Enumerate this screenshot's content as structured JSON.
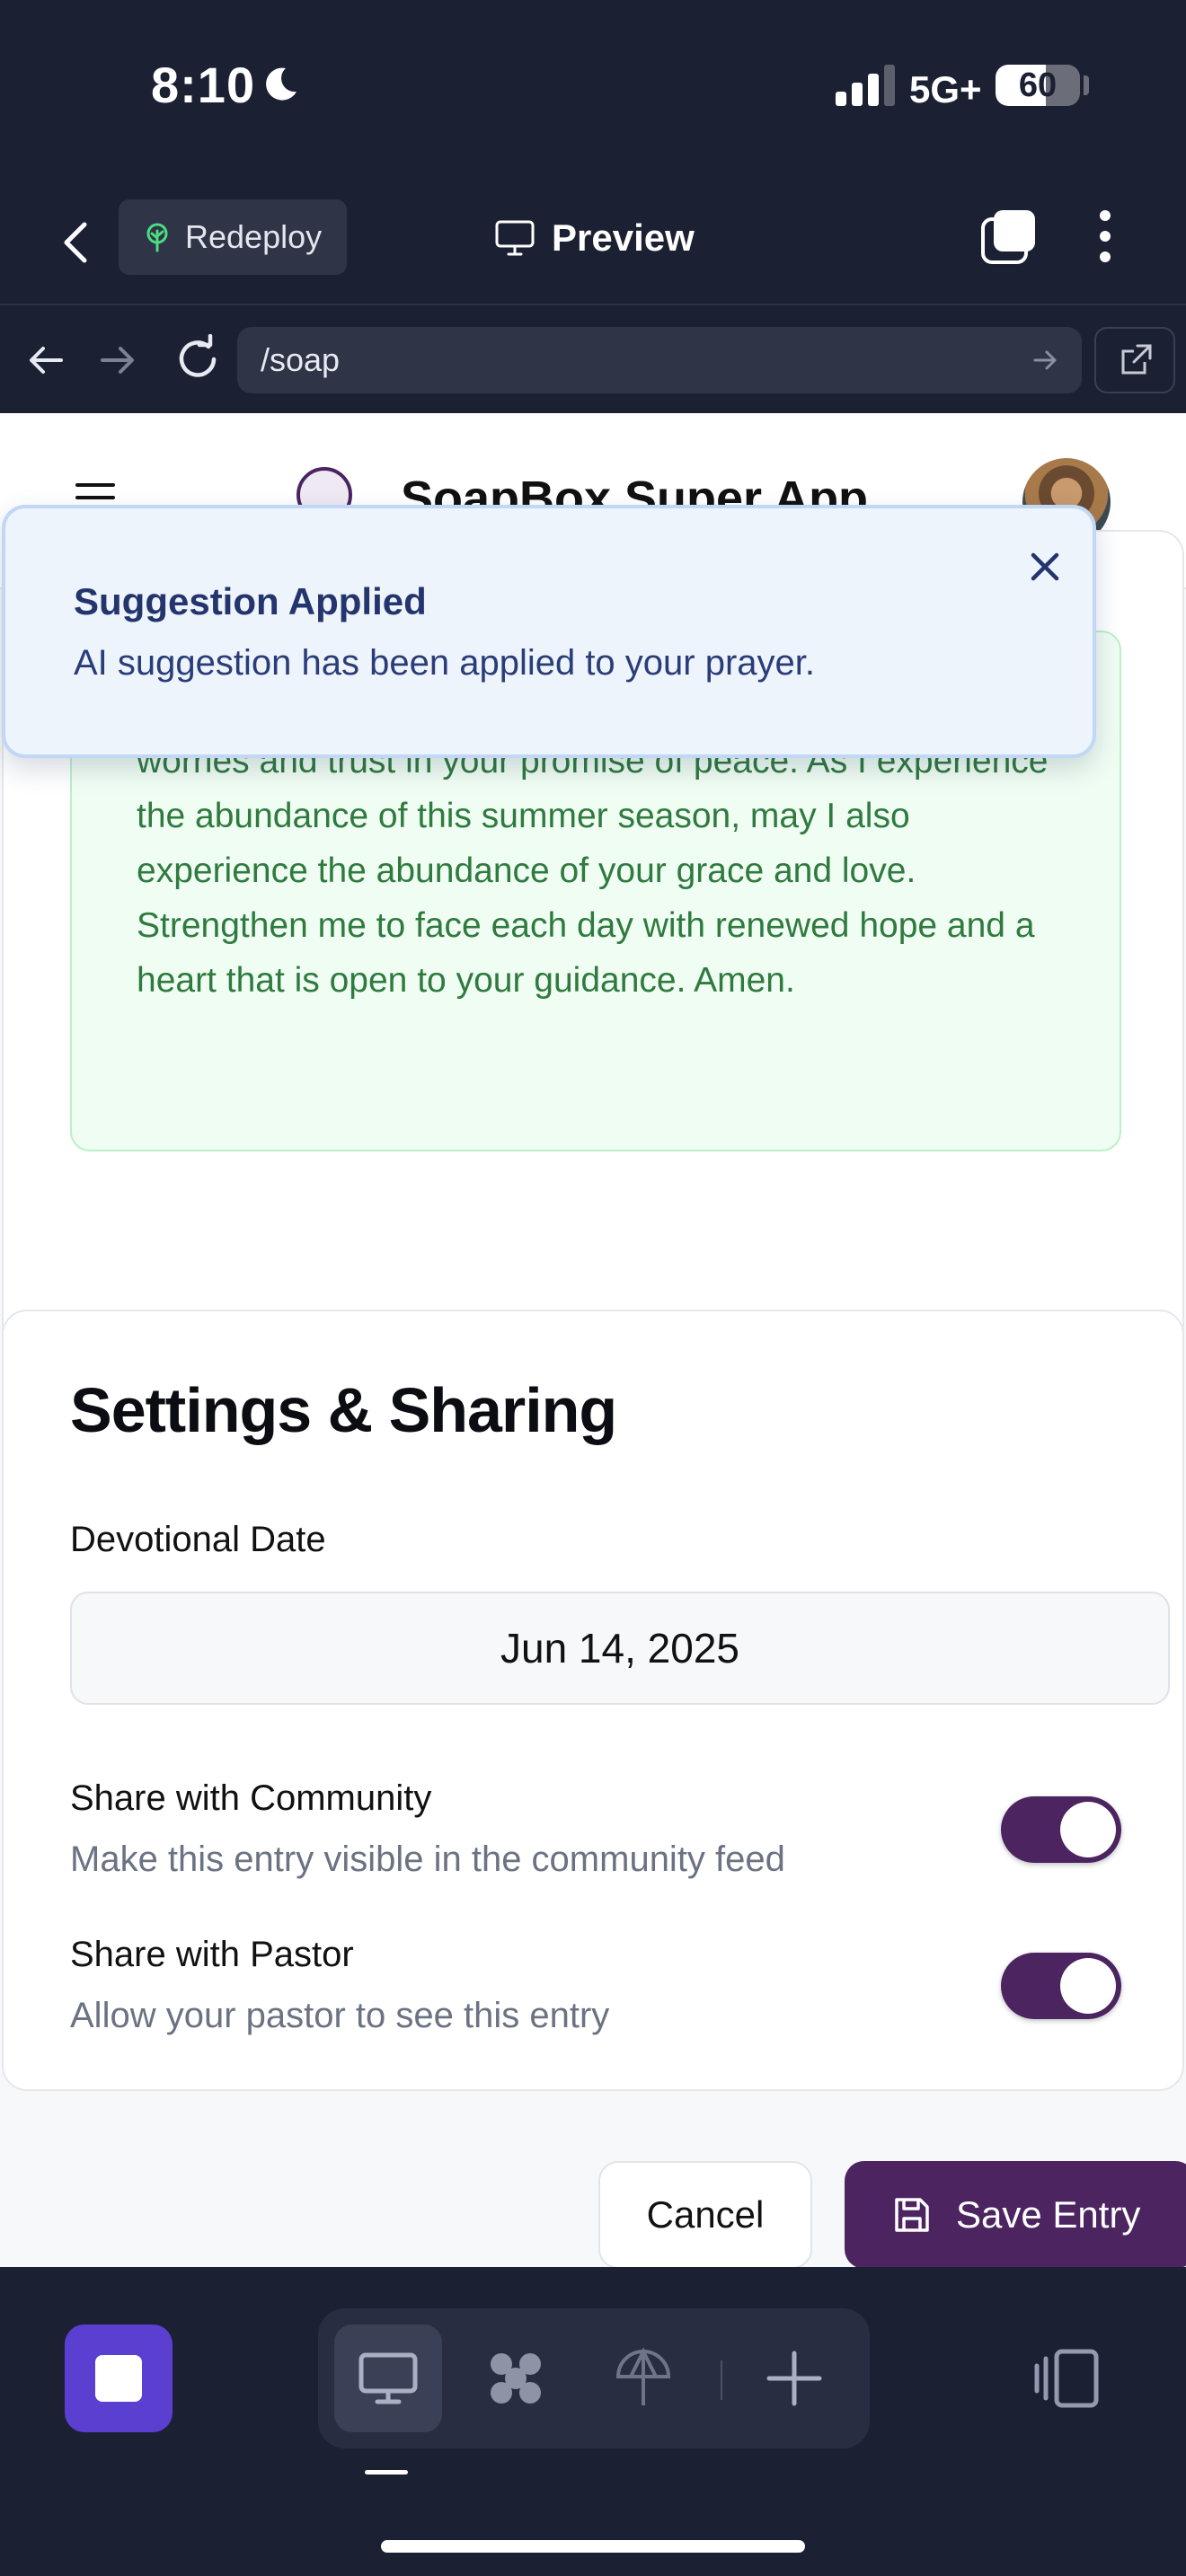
{
  "status_bar": {
    "time": "8:10",
    "network": "5G+",
    "battery": "60",
    "battery_level": 0.6
  },
  "app_bar": {
    "redeploy_label": "Redeploy",
    "preview_label": "Preview"
  },
  "browser": {
    "url": "/soap"
  },
  "site": {
    "title": "SoapBox Super App"
  },
  "prayer": {
    "text": "to find true rest in your presence. Teach me to release my worries and trust in your promise of peace. As I experience the abundance of this summer season, may I also experience the abundance of your grace and love. Strengthen me to face each day with renewed hope and a heart that is open to your guidance. Amen."
  },
  "toast": {
    "title": "Suggestion Applied",
    "message": "AI suggestion has been applied to your prayer."
  },
  "settings": {
    "title": "Settings & Sharing",
    "date_label": "Devotional Date",
    "date_value": "Jun 14, 2025",
    "share_community": {
      "title": "Share with Community",
      "subtitle": "Make this entry visible in the community feed",
      "enabled": true
    },
    "share_pastor": {
      "title": "Share with Pastor",
      "subtitle": "Allow your pastor to see this entry",
      "enabled": true
    }
  },
  "actions": {
    "cancel_label": "Cancel",
    "save_label": "Save Entry"
  },
  "colors": {
    "brand": "#4b2460",
    "toast_bg": "#eef4fb",
    "prayer_text": "#2f7a3e",
    "chrome_bg": "#1c2033",
    "stop_button": "#5b3fd1"
  },
  "icons": [
    "back-icon",
    "tree-icon",
    "monitor-icon",
    "tabs-icon",
    "more-icon",
    "arrow-left-icon",
    "arrow-right-icon",
    "reload-icon",
    "external-link-icon",
    "menu-icon",
    "close-icon",
    "save-icon",
    "stop-icon",
    "desktop-icon",
    "agent-icon",
    "deploy-icon",
    "plus-icon",
    "panel-icon"
  ]
}
